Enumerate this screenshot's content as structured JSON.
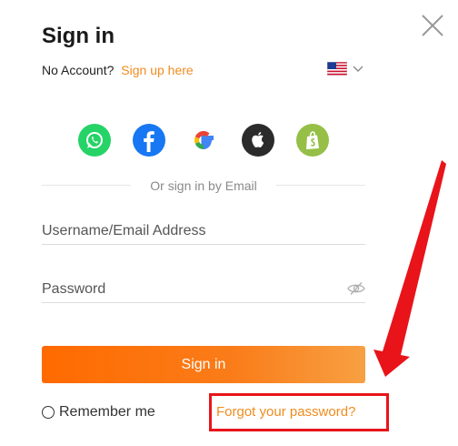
{
  "dialog": {
    "title": "Sign in",
    "no_account_text": "No Account?",
    "signup_link": "Sign up here",
    "language_flag_icon": "us-flag-icon"
  },
  "social": {
    "items": [
      {
        "name": "whatsapp",
        "color": "#25d366"
      },
      {
        "name": "facebook",
        "color": "#1877f2"
      },
      {
        "name": "google",
        "color": "#ffffff"
      },
      {
        "name": "apple",
        "color": "#2b2b2b"
      },
      {
        "name": "shopify",
        "color": "#95bf47"
      }
    ]
  },
  "email_section": {
    "divider_text": "Or sign in by Email",
    "username_placeholder": "Username/Email Address",
    "password_placeholder": "Password"
  },
  "actions": {
    "signin_label": "Sign in",
    "remember_label": "Remember me",
    "forgot_label": "Forgot your password?"
  },
  "colors": {
    "accent": "#f08c1e",
    "button_start": "#ff6a00",
    "button_end": "#f7a043",
    "annotation_red": "#e8141a"
  }
}
